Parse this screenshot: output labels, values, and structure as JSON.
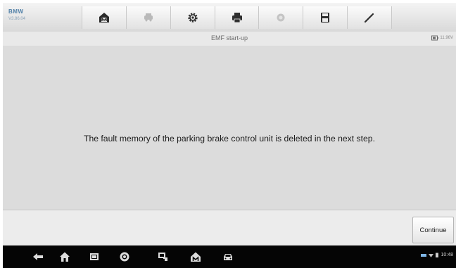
{
  "brand": {
    "name": "BMW",
    "version": "V3.86.04"
  },
  "toolbar": {
    "icons": [
      "home-icon",
      "vehicle-swap-icon",
      "settings-icon",
      "print-icon",
      "help-icon",
      "save-icon",
      "edit-icon"
    ]
  },
  "titlebar": {
    "title": "EMF start-up",
    "battery": "11.96V"
  },
  "content": {
    "message": "The fault memory of the parking brake control unit is deleted in the next step."
  },
  "footer": {
    "continue_label": "Continue"
  },
  "status": {
    "time": "10:48"
  },
  "colors": {
    "brand": "#4f7fa7",
    "content_bg": "#dcdcdc",
    "navbar_bg": "#050505"
  }
}
